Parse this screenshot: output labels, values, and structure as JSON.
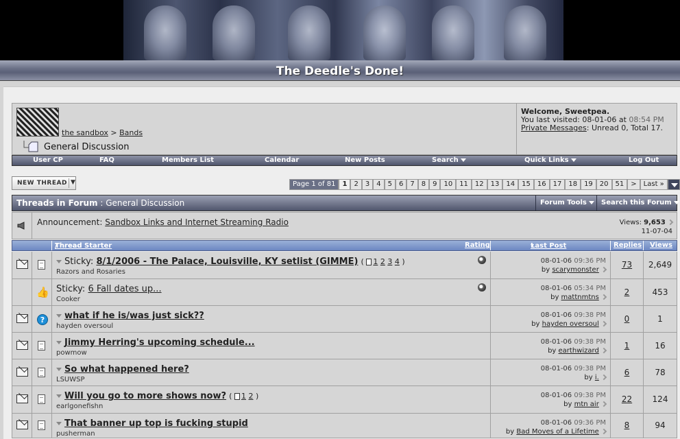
{
  "site": {
    "title": "The Deedle's Done!"
  },
  "nav": {
    "breadcrumb": [
      "the sandbox",
      "Bands"
    ],
    "breadcrumb_sep": ">",
    "forum_title": "General Discussion"
  },
  "welcome": {
    "greeting": "Welcome, Sweetpea.",
    "last_visited_label": "You last visited:",
    "last_visited_date": "08-01-06",
    "last_visited_at": "at",
    "last_visited_time": "08:54 PM",
    "pm_label": "Private Messages",
    "pm_status": ": Unread 0, Total 17."
  },
  "menu": [
    "User CP",
    "FAQ",
    "Members List",
    "Calendar",
    "New Posts",
    "Search",
    "Quick Links",
    "Log Out"
  ],
  "new_thread_label": "NEW THREAD",
  "pager": {
    "label": "Page 1 of 81",
    "pages": [
      "1",
      "2",
      "3",
      "4",
      "5",
      "6",
      "7",
      "8",
      "9",
      "10",
      "11",
      "12",
      "13",
      "14",
      "15",
      "16",
      "17",
      "18",
      "19",
      "20",
      "51",
      ">",
      "Last »"
    ],
    "current": "1"
  },
  "threads_header": {
    "prefix": "Threads in Forum",
    "sep": ":",
    "forum": "General Discussion",
    "forum_tools": "Forum Tools",
    "search_forum": "Search this Forum"
  },
  "announcement": {
    "label": "Announcement:",
    "title": "Sandbox Links and Internet Streaming Radio",
    "views_label": "Views:",
    "views": "9,653",
    "date": "11-07-04"
  },
  "columns": {
    "thread": "Thread",
    "sep": "/",
    "starter": "Thread Starter",
    "rating": "Rating",
    "last_post": "Last Post",
    "replies": "Replies",
    "views": "Views"
  },
  "threads": [
    {
      "sticky": "Sticky:",
      "title": "8/1/2006 - The Palace, Louisville, KY setlist (GIMME)",
      "pages": [
        "1",
        "2",
        "3",
        "4"
      ],
      "starter": "Razors and Rosaries",
      "rated": true,
      "date": "08-01-06",
      "time": "09:36 PM",
      "by": "by",
      "last_poster": "scarymonster",
      "replies": "73",
      "views": "2,649",
      "icon": "paper"
    },
    {
      "sticky": "Sticky:",
      "title": "6 Fall dates up...",
      "pages": [],
      "starter": "Cooker",
      "rated": true,
      "date": "08-01-06",
      "time": "05:34 PM",
      "by": "by",
      "last_poster": "mattnmtns",
      "replies": "2",
      "views": "453",
      "icon": "thumb"
    },
    {
      "sticky": "",
      "title": "what if he is/was just sick??",
      "pages": [],
      "starter": "hayden oversoul",
      "rated": false,
      "date": "08-01-06",
      "time": "09:38 PM",
      "by": "by",
      "last_poster": "hayden oversoul",
      "replies": "0",
      "views": "1",
      "icon": "question"
    },
    {
      "sticky": "",
      "title": "Jimmy Herring's upcoming schedule...",
      "pages": [],
      "starter": "powmow",
      "rated": false,
      "date": "08-01-06",
      "time": "09:38 PM",
      "by": "by",
      "last_poster": "earthwizard",
      "replies": "1",
      "views": "16",
      "icon": "paper"
    },
    {
      "sticky": "",
      "title": "So what happened here?",
      "pages": [],
      "starter": "LSUWSP",
      "rated": false,
      "date": "08-01-06",
      "time": "09:38 PM",
      "by": "by",
      "last_poster": "i.",
      "replies": "6",
      "views": "78",
      "icon": "paper"
    },
    {
      "sticky": "",
      "title": "Will you go to more shows now?",
      "pages": [
        "1",
        "2"
      ],
      "starter": "earlgonefishn",
      "rated": false,
      "date": "08-01-06",
      "time": "09:38 PM",
      "by": "by",
      "last_poster": "mtn air",
      "replies": "22",
      "views": "124",
      "icon": "paper"
    },
    {
      "sticky": "",
      "title": "That banner up top is fucking stupid",
      "pages": [],
      "starter": "pusherman",
      "rated": false,
      "date": "08-01-06",
      "time": "09:36 PM",
      "by": "by",
      "last_poster": "Bad Moves of a Lifetime",
      "replies": "8",
      "views": "94",
      "icon": "paper"
    }
  ]
}
